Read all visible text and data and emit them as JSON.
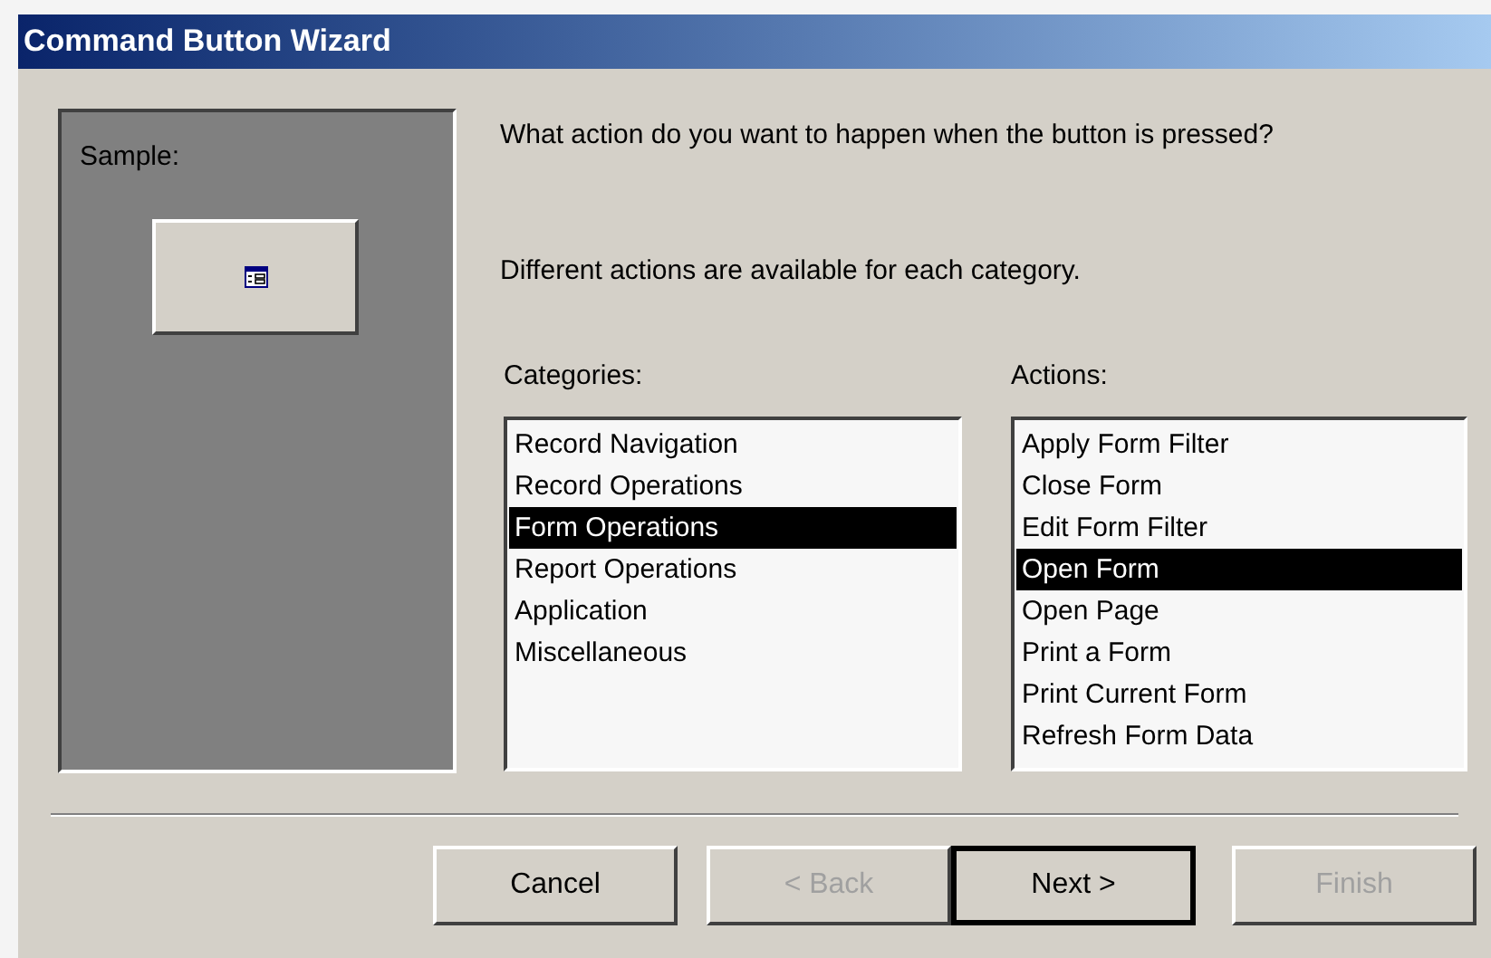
{
  "window": {
    "title": "Command Button Wizard"
  },
  "sample": {
    "label": "Sample:"
  },
  "question": "What action do you want to happen when the button is pressed?",
  "hint": "Different actions are available for each category.",
  "categories": {
    "label": "Categories:",
    "items": [
      {
        "label": "Record Navigation",
        "selected": false
      },
      {
        "label": "Record Operations",
        "selected": false
      },
      {
        "label": "Form Operations",
        "selected": true
      },
      {
        "label": "Report Operations",
        "selected": false
      },
      {
        "label": "Application",
        "selected": false
      },
      {
        "label": "Miscellaneous",
        "selected": false
      }
    ]
  },
  "actions": {
    "label": "Actions:",
    "items": [
      {
        "label": "Apply Form Filter",
        "selected": false
      },
      {
        "label": "Close Form",
        "selected": false
      },
      {
        "label": "Edit Form Filter",
        "selected": false
      },
      {
        "label": "Open Form",
        "selected": true
      },
      {
        "label": "Open Page",
        "selected": false
      },
      {
        "label": "Print a Form",
        "selected": false
      },
      {
        "label": "Print Current Form",
        "selected": false
      },
      {
        "label": "Refresh Form Data",
        "selected": false
      }
    ]
  },
  "buttons": [
    {
      "label": "Cancel",
      "disabled": false,
      "default": false
    },
    {
      "label": "< Back",
      "disabled": true,
      "default": false
    },
    {
      "label": "Next >",
      "disabled": false,
      "default": true
    },
    {
      "label": "Finish",
      "disabled": true,
      "default": false
    }
  ]
}
